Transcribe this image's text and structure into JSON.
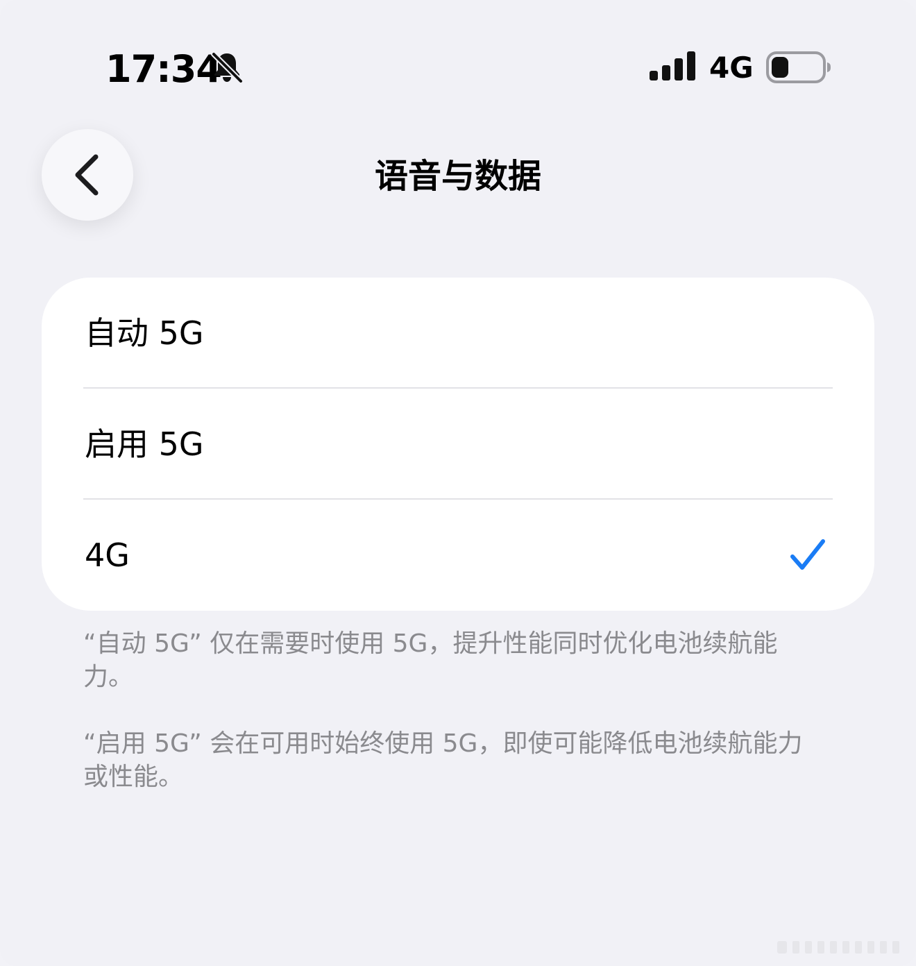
{
  "status_bar": {
    "time": "17:34",
    "network": "4G",
    "icons": [
      "bell-slash-icon",
      "cellular-signal-icon",
      "battery-icon"
    ],
    "signal_bars": 4,
    "battery_level": 0.15
  },
  "nav": {
    "back_icon": "chevron-left-icon",
    "title": "语音与数据"
  },
  "options": [
    {
      "label": "自动 5G",
      "selected": false
    },
    {
      "label": "启用 5G",
      "selected": false
    },
    {
      "label": "4G",
      "selected": true
    }
  ],
  "accent_color": "#1a7cf5",
  "notes": [
    "“自动 5G” 仅在需要时使用 5G，提升性能同时优化电池续航能力。",
    "“启用 5G” 会在可用时始终使用 5G，即使可能降低电池续航能力或性能。"
  ]
}
